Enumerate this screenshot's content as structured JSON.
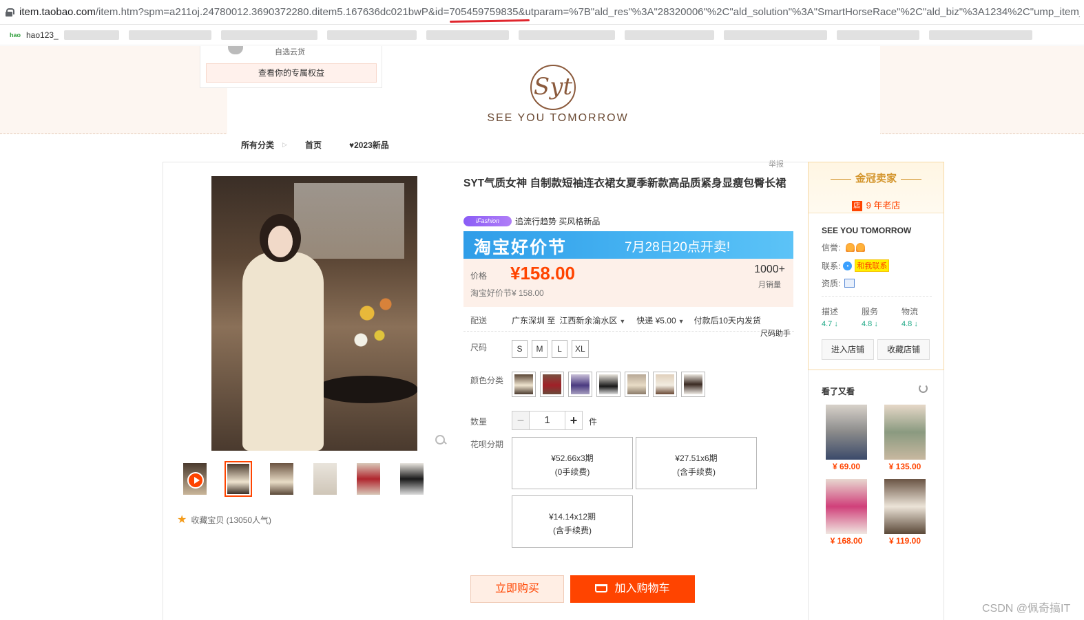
{
  "browser": {
    "url_host": "item.taobao.com",
    "url_path": "/item.htm?spm=a211oj.24780012.3690372280.ditem5.167636dc021bwP&id=705459759835&utparam=%7B\"ald_res\"%3A\"28320006\"%2C\"ald_solution\"%3A\"SmartHorseRace\"%2C\"ald_biz\"%3A1234%2C\"ump_item_",
    "bookmark_label": "hao123_"
  },
  "header": {
    "coupon_sub": "自选云货",
    "coupon_label": "查看你的专属权益",
    "logo_mark": "Syt",
    "logo_text": "SEE YOU TOMORROW"
  },
  "nav": {
    "items": [
      "所有分类",
      "首页",
      "♥2023新品"
    ]
  },
  "report_label": "举报",
  "product": {
    "title": "SYT气质女神 自制款短袖连衣裙女夏季新款高品质紧身显瘦包臀长裙",
    "tag_badge": "iFashion",
    "tag_text": "追流行趋势 买风格新品",
    "banner_title": "淘宝好价节",
    "banner_date": "7月28日20点开卖!",
    "price_label": "价格",
    "price": "¥158.00",
    "sales_count": "1000+",
    "sales_label": "月销量",
    "fest_price": "淘宝好价节¥ 158.00",
    "ship_label": "配送",
    "ship_from": "广东深圳 至",
    "ship_to": "江西新余渝水区",
    "ship_fee": "快递 ¥5.00",
    "ship_time": "付款后10天内发货",
    "size_help": "尺码助手",
    "size_label": "尺码",
    "sizes": [
      "S",
      "M",
      "L",
      "XL"
    ],
    "color_label": "颜色分类",
    "qty_label": "数量",
    "qty_value": "1",
    "qty_unit": "件",
    "installment_label": "花呗分期",
    "installments": [
      {
        "amount": "¥52.66x3期",
        "fee": "(0手续费)"
      },
      {
        "amount": "¥27.51x6期",
        "fee": "(含手续费)"
      },
      {
        "amount": "¥14.14x12期",
        "fee": "(含手续费)"
      }
    ],
    "buy_now": "立即购买",
    "add_cart": "加入购物车",
    "favorite": "收藏宝贝 (13050人气)"
  },
  "seller": {
    "crown_title": "金冠卖家",
    "shop_icon": "店",
    "age": "9 年老店",
    "name": "SEE YOU TOMORROW",
    "credit_label": "信誉:",
    "contact_label": "联系:",
    "contact_btn": "和我联系",
    "cert_label": "资质:",
    "scores": [
      {
        "label": "描述",
        "value": "4.7"
      },
      {
        "label": "服务",
        "value": "4.8"
      },
      {
        "label": "物流",
        "value": "4.8"
      }
    ],
    "enter_shop": "进入店铺",
    "fav_shop": "收藏店铺"
  },
  "also_viewed": {
    "title": "看了又看",
    "items": [
      {
        "price": "¥ 69.00"
      },
      {
        "price": "¥ 135.00"
      },
      {
        "price": "¥ 168.00"
      },
      {
        "price": "¥ 119.00"
      }
    ]
  },
  "watermark": "CSDN @佩奇搞IT",
  "colors": {
    "accent": "#ff4400",
    "seller_gold": "#d4962e",
    "banner_blue": "#2f9de8"
  }
}
